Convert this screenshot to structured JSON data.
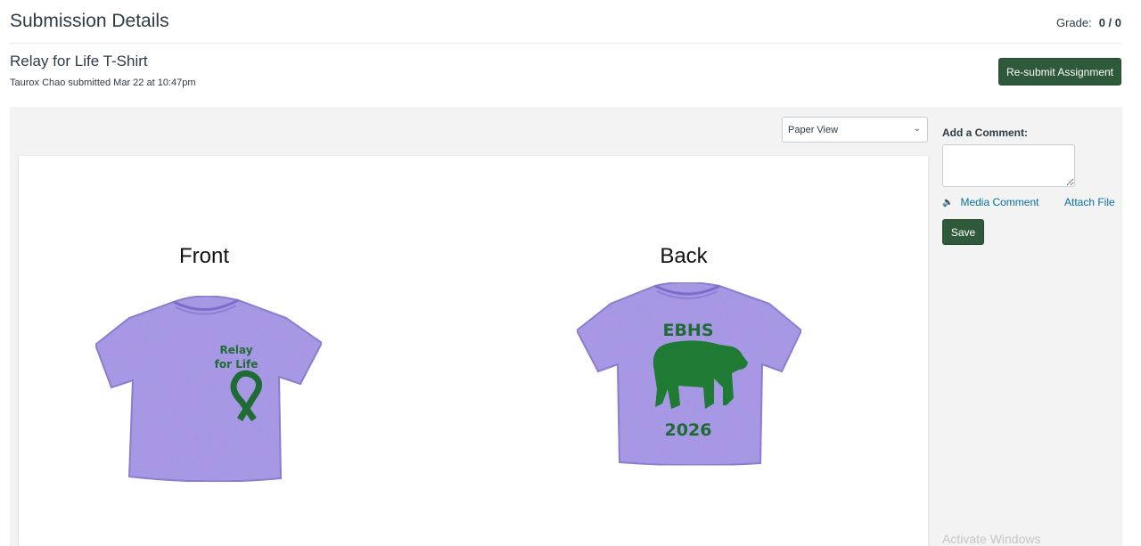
{
  "header": {
    "title": "Submission Details",
    "grade_label": "Grade:",
    "grade_value": "0 / 0"
  },
  "assignment": {
    "title": "Relay for Life T-Shirt",
    "submitter": "Taurox Chao",
    "submitted_text": " submitted Mar 22 at 10:47pm"
  },
  "buttons": {
    "resubmit": "Re-submit Assignment",
    "save": "Save"
  },
  "view_select": {
    "selected": "Paper View"
  },
  "submission_image": {
    "front_label": "Front",
    "back_label": "Back",
    "front_text_line1": "Relay",
    "front_text_line2": "for Life",
    "back_text_top": "EBHS",
    "back_text_bottom": "2026",
    "shirt_color": "#9f8fe3",
    "print_color": "#1f6b34"
  },
  "comments": {
    "label": "Add a Comment:",
    "media_comment": "Media Comment",
    "attach_file": "Attach File"
  },
  "watermark": "Activate Windows",
  "colors": {
    "accent_green": "#2e5a3b",
    "link_blue": "#0770a3",
    "panel_bg": "#f2f3f2"
  },
  "icons": {
    "speaker": "speaker-icon",
    "chevron": "chevron-down-icon"
  }
}
